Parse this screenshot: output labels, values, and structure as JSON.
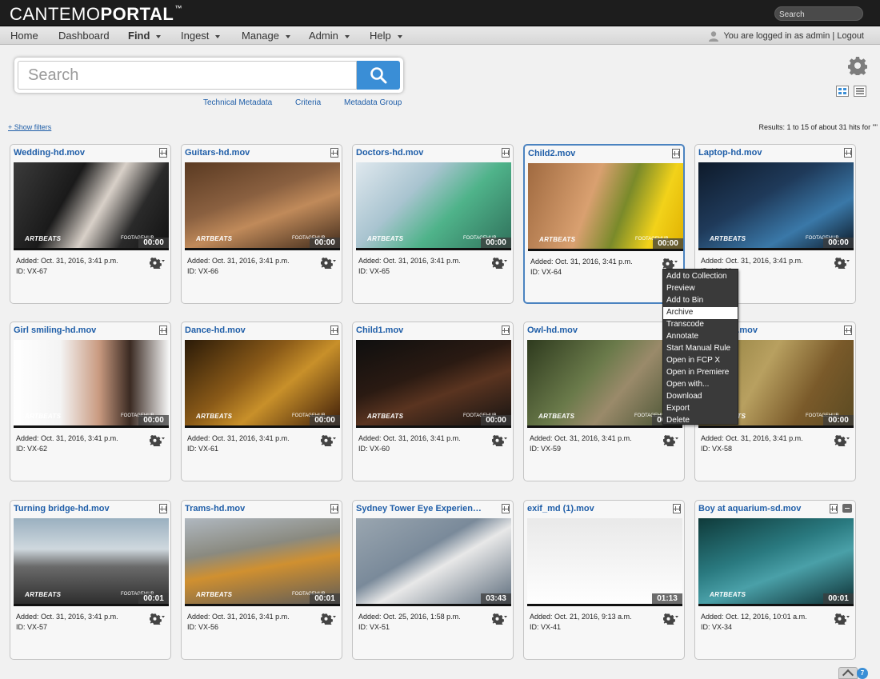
{
  "header": {
    "logo_light": "CANTEMO",
    "logo_bold": "PORTAL",
    "logo_tm": "™",
    "search_placeholder": "Search"
  },
  "nav": {
    "home": "Home",
    "dashboard": "Dashboard",
    "find": "Find",
    "ingest": "Ingest",
    "manage": "Manage",
    "admin": "Admin",
    "help": "Help",
    "login_text": "You are logged in as admin",
    "separator": "|",
    "logout": "Logout"
  },
  "search": {
    "placeholder": "Search",
    "links": {
      "technical": "Technical Metadata",
      "criteria": "Criteria",
      "group": "Metadata Group"
    }
  },
  "filters": {
    "show_filters": "+ Show filters",
    "results": "Results: 1 to 15 of about 31 hits for \"\""
  },
  "items": [
    {
      "title": "Wedding-hd.mov",
      "duration": "00:00",
      "added": "Added: Oct. 31, 2016, 3:41 p.m.",
      "id": "ID: VX-67",
      "wm_left": "ARTBEATS",
      "wm_right": "FOOTAGEHUB"
    },
    {
      "title": "Guitars-hd.mov",
      "duration": "00:00",
      "added": "Added: Oct. 31, 2016, 3:41 p.m.",
      "id": "ID: VX-66",
      "wm_left": "ARTBEATS",
      "wm_right": "FOOTAGEHUB"
    },
    {
      "title": "Doctors-hd.mov",
      "duration": "00:00",
      "added": "Added: Oct. 31, 2016, 3:41 p.m.",
      "id": "ID: VX-65",
      "wm_left": "ARTBEATS",
      "wm_right": "FOOTAGEHUB"
    },
    {
      "title": "Child2.mov",
      "duration": "00:00",
      "added": "Added: Oct. 31, 2016, 3:41 p.m.",
      "id": "ID: VX-64",
      "wm_left": "ARTBEATS",
      "wm_right": "FOOTAGEHUB"
    },
    {
      "title": "Laptop-hd.mov",
      "duration": "00:00",
      "added": "Added: Oct. 31, 2016, 3:41 p.m.",
      "id": "ID: VX-63",
      "wm_left": "ARTBEATS",
      "wm_right": "FOOTAGEHUB"
    },
    {
      "title": "Girl smiling-hd.mov",
      "duration": "00:00",
      "added": "Added: Oct. 31, 2016, 3:41 p.m.",
      "id": "ID: VX-62",
      "wm_left": "ARTBEATS",
      "wm_right": "FOOTAGEHUB"
    },
    {
      "title": "Dance-hd.mov",
      "duration": "00:00",
      "added": "Added: Oct. 31, 2016, 3:41 p.m.",
      "id": "ID: VX-61",
      "wm_left": "ARTBEATS",
      "wm_right": "FOOTAGEHUB"
    },
    {
      "title": "Child1.mov",
      "duration": "00:00",
      "added": "Added: Oct. 31, 2016, 3:41 p.m.",
      "id": "ID: VX-60",
      "wm_left": "ARTBEATS",
      "wm_right": "FOOTAGEHUB"
    },
    {
      "title": "Owl-hd.mov",
      "duration": "00:00",
      "added": "Added: Oct. 31, 2016, 3:41 p.m.",
      "id": "ID: VX-59",
      "wm_left": "ARTBEATS",
      "wm_right": "FOOTAGEHUB"
    },
    {
      "title": "…ting-hd.mov",
      "duration": "00:00",
      "added": "Added: Oct. 31, 2016, 3:41 p.m.",
      "id": "ID: VX-58",
      "wm_left": "ARTBEATS",
      "wm_right": "FOOTAGEHUB"
    },
    {
      "title": "Turning bridge-hd.mov",
      "duration": "00:01",
      "added": "Added: Oct. 31, 2016, 3:41 p.m.",
      "id": "ID: VX-57",
      "wm_left": "ARTBEATS",
      "wm_right": "FOOTAGEHUB"
    },
    {
      "title": "Trams-hd.mov",
      "duration": "00:01",
      "added": "Added: Oct. 31, 2016, 3:41 p.m.",
      "id": "ID: VX-56",
      "wm_left": "ARTBEATS",
      "wm_right": "FOOTAGEHUB"
    },
    {
      "title": "Sydney Tower Eye Experience in…",
      "duration": "03:43",
      "added": "Added: Oct. 25, 2016, 1:58 p.m.",
      "id": "ID: VX-51",
      "wm_left": "",
      "wm_right": ""
    },
    {
      "title": "exif_md (1).mov",
      "duration": "01:13",
      "added": "Added: Oct. 21, 2016, 9:13 a.m.",
      "id": "ID: VX-41",
      "wm_left": "",
      "wm_right": ""
    },
    {
      "title": "Boy at aquarium-sd.mov",
      "duration": "00:01",
      "added": "Added: Oct. 12, 2016, 10:01 a.m.",
      "id": "ID: VX-34",
      "wm_left": "ARTBEATS",
      "wm_right": ""
    }
  ],
  "context_menu": [
    "Add to Collection",
    "Preview",
    "Add to Bin",
    "Archive",
    "Transcode",
    "Annotate",
    "Start Manual Rule",
    "Open in FCP X",
    "Open in Premiere",
    "Open with...",
    "Download",
    "Export",
    "Delete"
  ],
  "context_menu_highlight": "Archive",
  "notification_count": "7",
  "colors": {
    "link": "#1f5ea8",
    "search_button": "#3a8ed6",
    "selected_border": "#4b83c0",
    "header_bg": "#1d1d1d",
    "menu_bg": "#3a3a3a"
  }
}
